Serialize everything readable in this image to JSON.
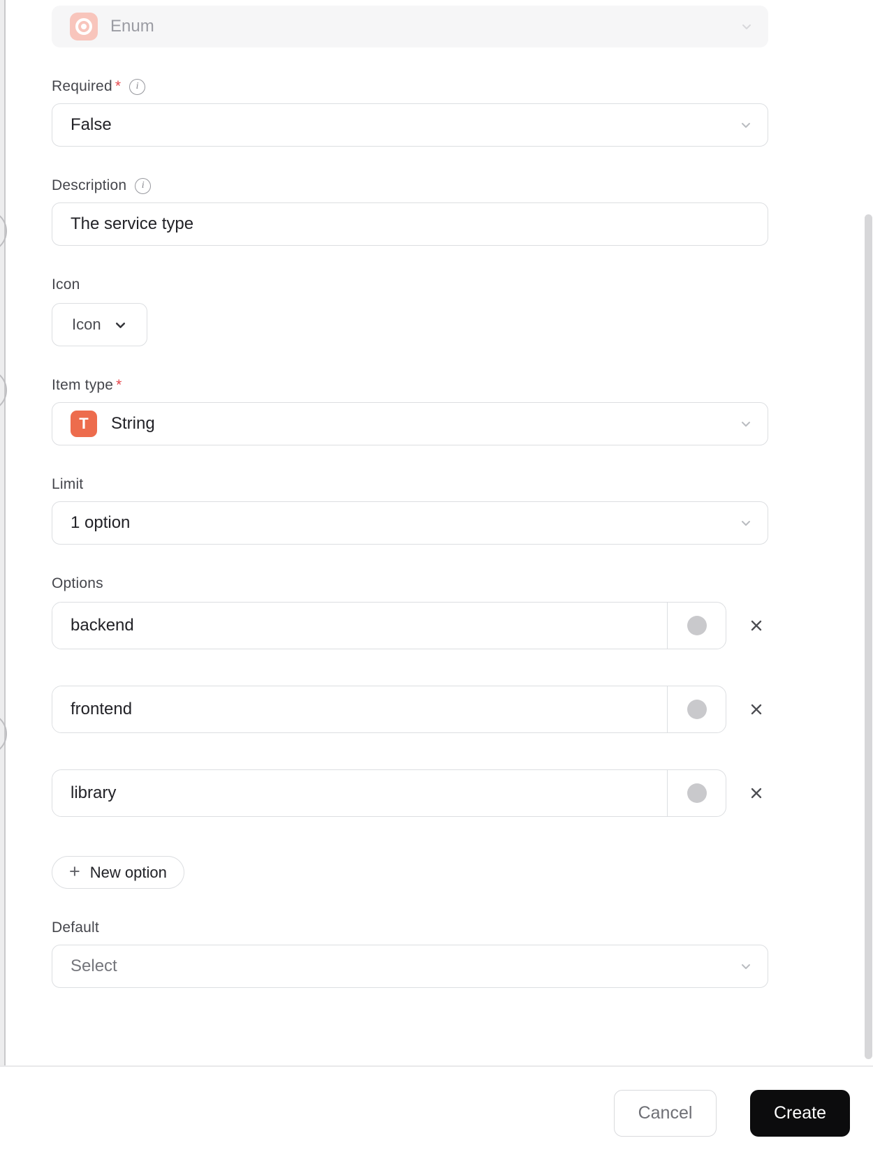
{
  "dialog": {
    "type_selector": {
      "value": "Enum"
    },
    "required": {
      "label": "Required",
      "asterisk": "*",
      "value": "False"
    },
    "description": {
      "label": "Description",
      "value": "The service type"
    },
    "icon_field": {
      "label": "Icon",
      "button_label": "Icon"
    },
    "item_type": {
      "label": "Item type",
      "asterisk": "*",
      "icon_letter": "T",
      "value": "String"
    },
    "limit": {
      "label": "Limit",
      "value": "1 option"
    },
    "options": {
      "label": "Options",
      "items": [
        {
          "value": "backend"
        },
        {
          "value": "frontend"
        },
        {
          "value": "library"
        }
      ],
      "new_option": {
        "plus": "+",
        "label": "New option"
      }
    },
    "default_field": {
      "label": "Default",
      "placeholder": "Select"
    },
    "info_icon_glyph": "i",
    "footer": {
      "cancel_label": "Cancel",
      "create_label": "Create"
    }
  },
  "colors": {
    "enum_icon_bg": "#f8c5bc",
    "string_icon_bg": "#ed6c4d",
    "asterisk_red": "#e5484d",
    "swatch_gray": "#c9c9cc",
    "create_button_bg": "#0c0c0d",
    "border_gray": "#dcdee1",
    "disabled_field_bg": "#f6f6f7"
  }
}
